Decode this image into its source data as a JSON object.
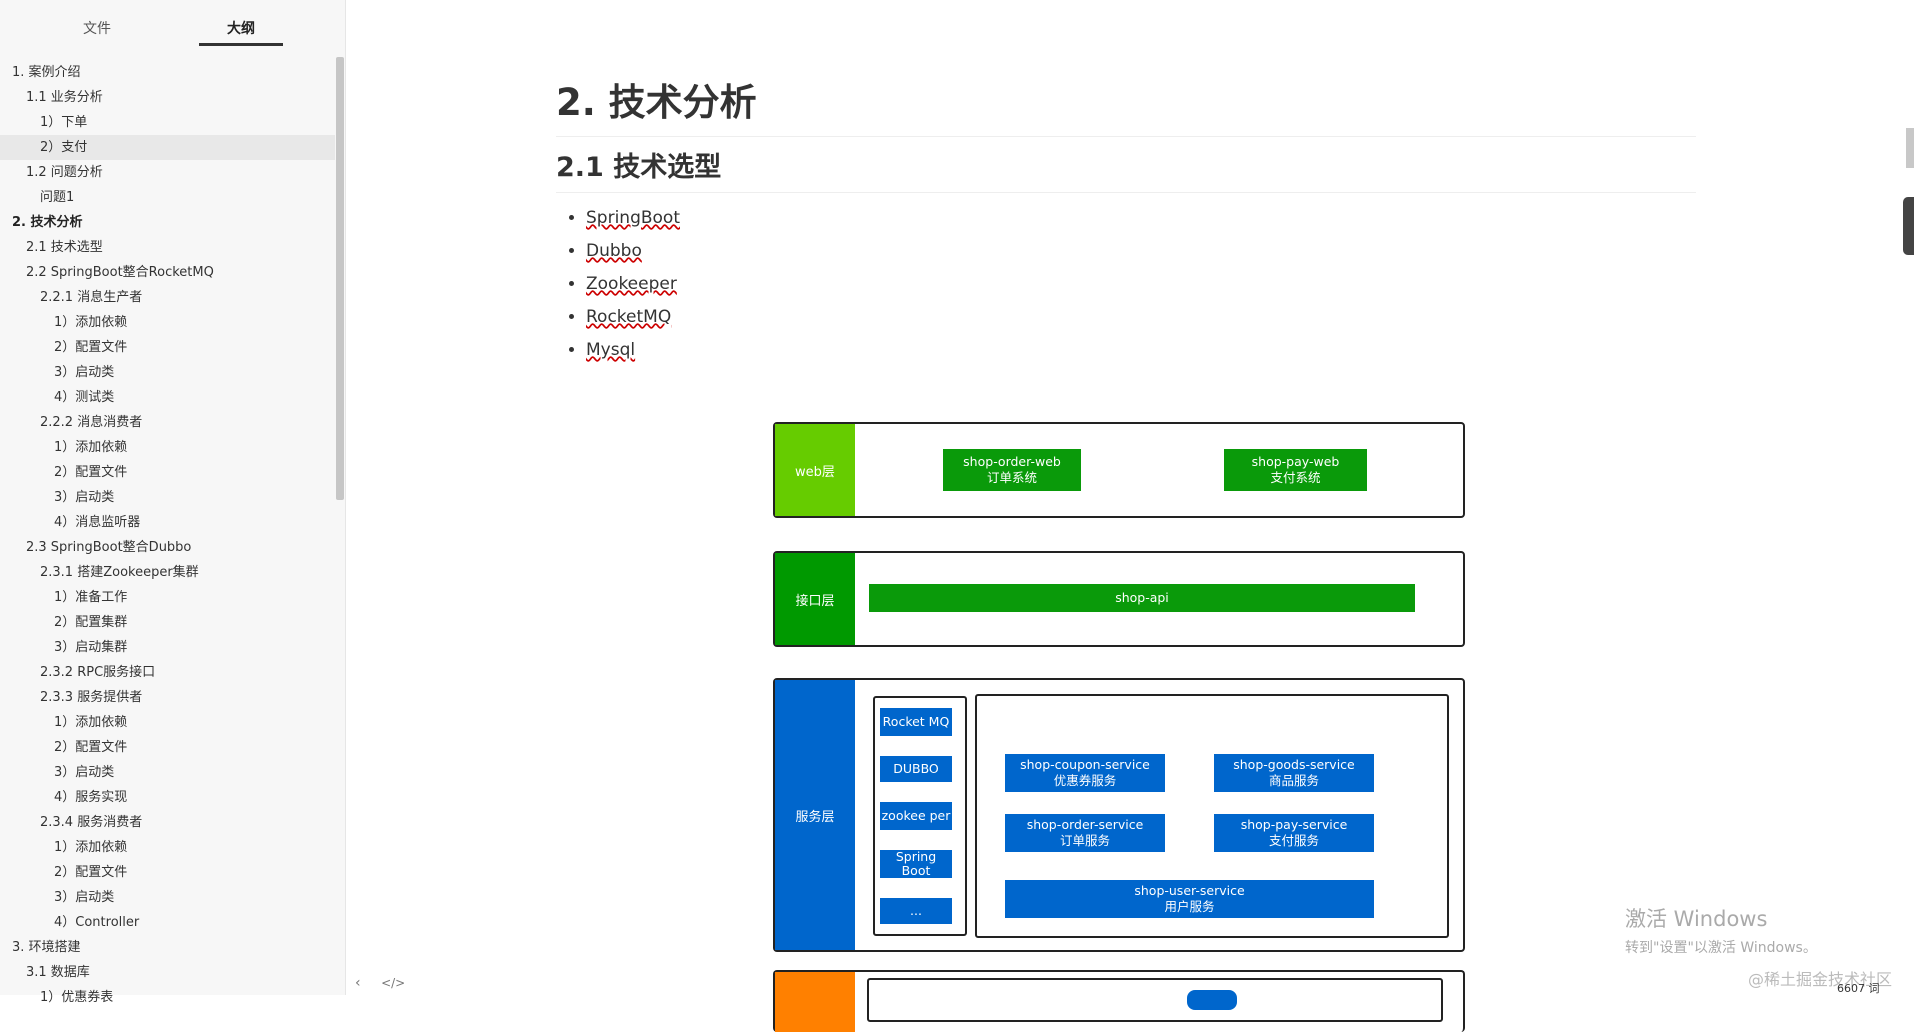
{
  "sidebar": {
    "tabs": [
      {
        "label": "文件"
      },
      {
        "label": "大纲"
      }
    ],
    "outline": [
      {
        "label": "1. 案例介绍",
        "indent": 0
      },
      {
        "label": "1.1 业务分析",
        "indent": 1
      },
      {
        "label": "1）下单",
        "indent": 2
      },
      {
        "label": "2）支付",
        "indent": 2,
        "active": true
      },
      {
        "label": "1.2 问题分析",
        "indent": 1
      },
      {
        "label": "问题1",
        "indent": 2
      },
      {
        "label": "2. 技术分析",
        "indent": 0,
        "bold": true
      },
      {
        "label": "2.1 技术选型",
        "indent": 1
      },
      {
        "label": "2.2 SpringBoot整合RocketMQ",
        "indent": 1
      },
      {
        "label": "2.2.1 消息生产者",
        "indent": 2
      },
      {
        "label": "1）添加依赖",
        "indent": 3
      },
      {
        "label": "2）配置文件",
        "indent": 3
      },
      {
        "label": "3）启动类",
        "indent": 3
      },
      {
        "label": "4）测试类",
        "indent": 3
      },
      {
        "label": "2.2.2 消息消费者",
        "indent": 2
      },
      {
        "label": "1）添加依赖",
        "indent": 3
      },
      {
        "label": "2）配置文件",
        "indent": 3
      },
      {
        "label": "3）启动类",
        "indent": 3
      },
      {
        "label": "4）消息监听器",
        "indent": 3
      },
      {
        "label": "2.3 SpringBoot整合Dubbo",
        "indent": 1
      },
      {
        "label": "2.3.1 搭建Zookeeper集群",
        "indent": 2
      },
      {
        "label": "1）准备工作",
        "indent": 3
      },
      {
        "label": "2）配置集群",
        "indent": 3
      },
      {
        "label": "3）启动集群",
        "indent": 3
      },
      {
        "label": "2.3.2 RPC服务接口",
        "indent": 2
      },
      {
        "label": "2.3.3 服务提供者",
        "indent": 2
      },
      {
        "label": "1）添加依赖",
        "indent": 3
      },
      {
        "label": "2）配置文件",
        "indent": 3
      },
      {
        "label": "3）启动类",
        "indent": 3
      },
      {
        "label": "4）服务实现",
        "indent": 3
      },
      {
        "label": "2.3.4 服务消费者",
        "indent": 2
      },
      {
        "label": "1）添加依赖",
        "indent": 3
      },
      {
        "label": "2）配置文件",
        "indent": 3
      },
      {
        "label": "3）启动类",
        "indent": 3
      },
      {
        "label": "4）Controller",
        "indent": 3
      },
      {
        "label": "3. 环境搭建",
        "indent": 0
      },
      {
        "label": "3.1 数据库",
        "indent": 1
      },
      {
        "label": "1）优惠券表",
        "indent": 2
      }
    ],
    "footer": {
      "back": "‹",
      "source": "</>"
    }
  },
  "main": {
    "h1": "2. 技术分析",
    "h2": "2.1 技术选型",
    "list": [
      "SpringBoot",
      "Dubbo",
      "Zookeeper",
      "RocketMQ",
      "Mysql"
    ]
  },
  "diagram": {
    "web_layer": {
      "label": "web层",
      "boxes": [
        {
          "line1": "shop-order-web",
          "line2": "订单系统"
        },
        {
          "line1": "shop-pay-web",
          "line2": "支付系统"
        }
      ]
    },
    "api_layer": {
      "label": "接口层",
      "box": "shop-api"
    },
    "service_layer": {
      "label": "服务层",
      "tools": [
        "Rocket MQ",
        "DUBBO",
        "zookee per",
        "Spring Boot",
        "..."
      ],
      "services": [
        {
          "line1": "shop-coupon-service",
          "line2": "优惠券服务"
        },
        {
          "line1": "shop-goods-service",
          "line2": "商品服务"
        },
        {
          "line1": "shop-order-service",
          "line2": "订单服务"
        },
        {
          "line1": "shop-pay-service",
          "line2": "支付服务"
        },
        {
          "line1": "shop-user-service",
          "line2": "用户服务"
        }
      ]
    },
    "colors": {
      "web": "#66cc00",
      "api": "#009900",
      "service": "#0066cc",
      "data": "#ff8000",
      "green_box": "#0a9a0a",
      "blue_box": "#0066cc"
    }
  },
  "overlay": {
    "watermark_title": "激活 Windows",
    "watermark_sub": "转到\"设置\"以激活 Windows。",
    "credit": "@稀土掘金技术社区",
    "wordcount": "6607 词"
  }
}
